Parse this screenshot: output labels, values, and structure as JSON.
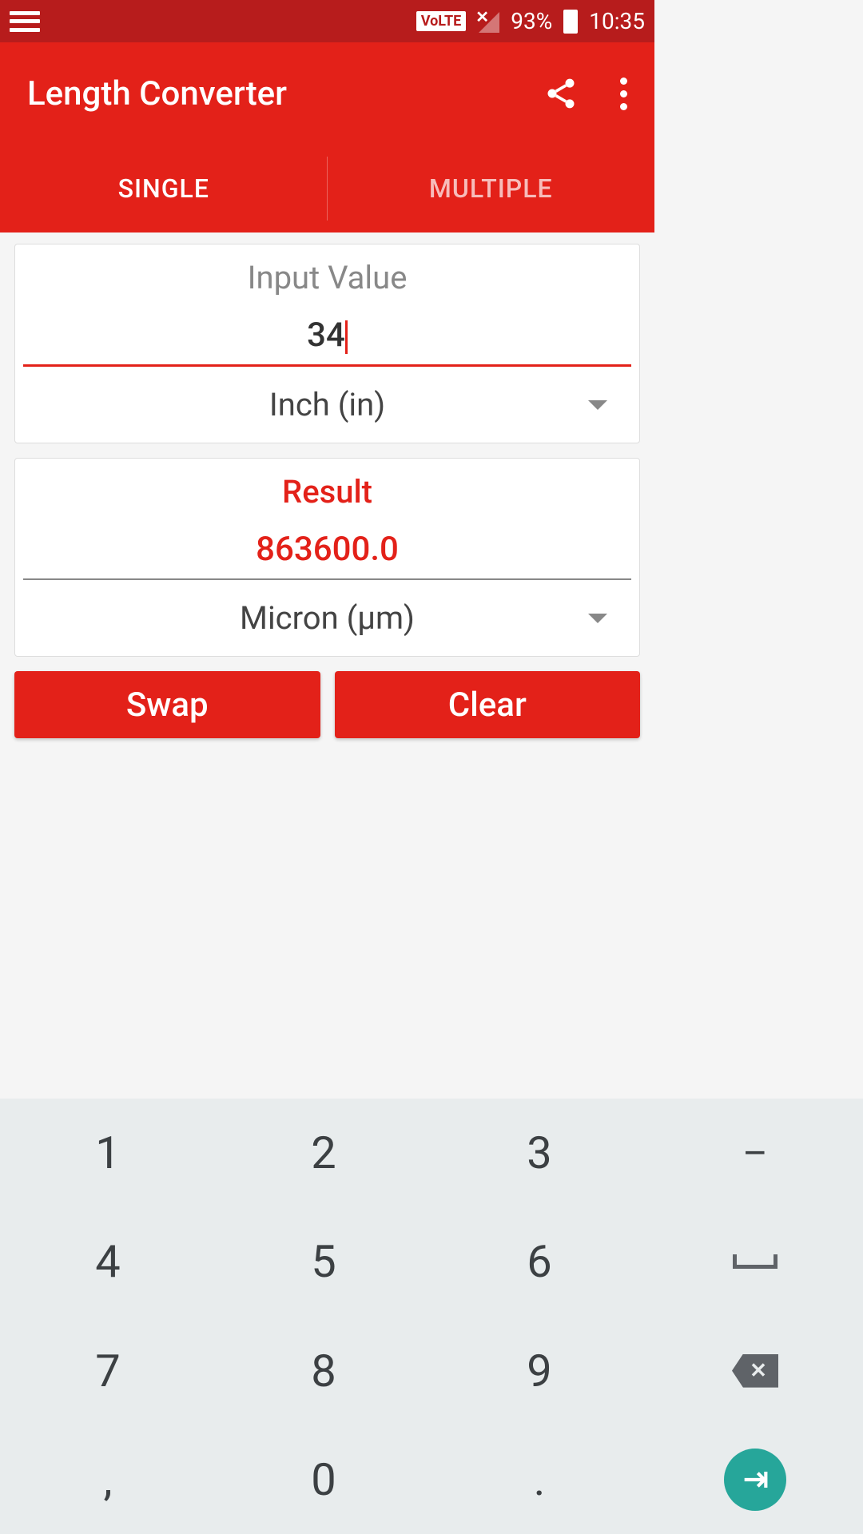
{
  "status": {
    "volte": "VoLTE",
    "battery": "93%",
    "time": "10:35"
  },
  "app": {
    "title": "Length Converter"
  },
  "tabs": {
    "single": "SINGLE",
    "multiple": "MULTIPLE"
  },
  "input": {
    "label": "Input Value",
    "value": "34",
    "unit": "Inch (in)"
  },
  "result": {
    "label": "Result",
    "value": "863600.0",
    "unit": "Micron (µm)"
  },
  "buttons": {
    "swap": "Swap",
    "clear": "Clear"
  },
  "keypad": {
    "k1": "1",
    "k2": "2",
    "k3": "3",
    "minus": "–",
    "k4": "4",
    "k5": "5",
    "k6": "6",
    "k7": "7",
    "k8": "8",
    "k9": "9",
    "comma": ",",
    "k0": "0",
    "dot": ".",
    "bsx": "✕"
  }
}
